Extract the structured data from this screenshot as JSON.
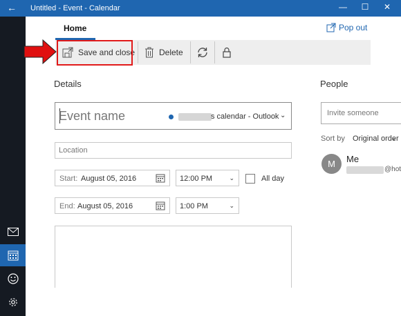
{
  "titlebar": {
    "title": "Untitled - Event - Calendar",
    "back_icon": "back-arrow-icon",
    "min_icon": "minimize-icon",
    "max_icon": "maximize-icon",
    "close_icon": "close-icon",
    "bar_color": "#1f66b0"
  },
  "rail": {
    "items": [
      {
        "name": "mail",
        "icon": "mail-icon",
        "active": false
      },
      {
        "name": "calendar",
        "icon": "calendar-icon",
        "active": true
      },
      {
        "name": "feedback",
        "icon": "smiley-icon",
        "active": false
      },
      {
        "name": "settings",
        "icon": "gear-icon",
        "active": false
      }
    ]
  },
  "tabs": {
    "home_label": "Home"
  },
  "popout_label": "Pop out",
  "toolbar": {
    "save_label": "Save and close",
    "delete_label": "Delete",
    "repeat_icon": "repeat-icon",
    "private_icon": "lock-icon",
    "highlight_color": "#e11919"
  },
  "form": {
    "details_heading": "Details",
    "event_name_placeholder": "Event name",
    "calendar_name": "s calendar - Outlook",
    "location_placeholder": "Location",
    "start_label": "Start:",
    "start_date": "August 05, 2016",
    "start_time": "12:00 PM",
    "end_label": "End:",
    "end_date": "August 05, 2016",
    "end_time": "1:00 PM",
    "all_day_label": "All day",
    "all_day_checked": false
  },
  "people": {
    "heading": "People",
    "invite_placeholder": "Invite someone",
    "sort_label": "Sort by",
    "sort_value": "Original order",
    "attendee_initial": "M",
    "attendee_name": "Me",
    "attendee_domain": "@hot"
  }
}
